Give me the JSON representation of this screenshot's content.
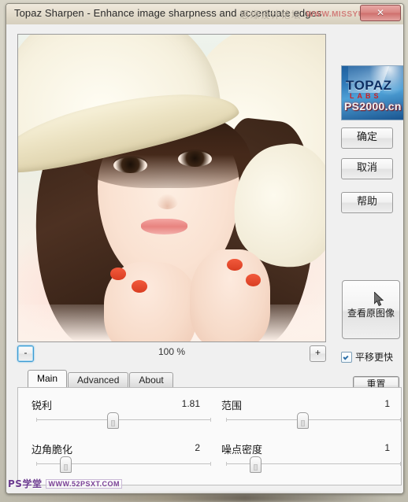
{
  "window": {
    "title": "Topaz Sharpen - Enhance image sharpness and accentuate edges",
    "close_label": "✕"
  },
  "watermark_top": {
    "cn": "思缘设计论坛",
    "en": "WWW.MISSYUAN.COM"
  },
  "watermark_bottom": {
    "brand": "PS学堂",
    "url": "WWW.52PSXT.COM"
  },
  "preview": {
    "alt": "portrait of young woman wearing a white straw sun hat"
  },
  "zoom": {
    "minus_label": "-",
    "plus_label": "+",
    "level_label": "100 %"
  },
  "logo": {
    "topaz": "TOPAZ",
    "labs": "LABS",
    "site": "PS2000.cn"
  },
  "buttons": {
    "ok": "确定",
    "cancel": "取消",
    "help": "帮助",
    "view_original": "查看原图像",
    "reset": "重置"
  },
  "checkbox": {
    "pan_faster": "平移更快",
    "checked": true
  },
  "tabs": [
    {
      "label": "Main",
      "active": true
    },
    {
      "label": "Advanced",
      "active": false
    },
    {
      "label": "About",
      "active": false
    }
  ],
  "parameters": [
    {
      "label": "锐利",
      "value": "1.81",
      "percent": 42
    },
    {
      "label": "范围",
      "value": "1",
      "percent": 42
    },
    {
      "label": "边角脆化",
      "value": "2",
      "percent": 16
    },
    {
      "label": "噪点密度",
      "value": "1",
      "percent": 16
    }
  ],
  "colors": {
    "accent": "#3c9ad1",
    "logo_blue": "#1f5f9e",
    "logo_red": "#d01f1f",
    "title_bg": "#e4ddcd"
  }
}
